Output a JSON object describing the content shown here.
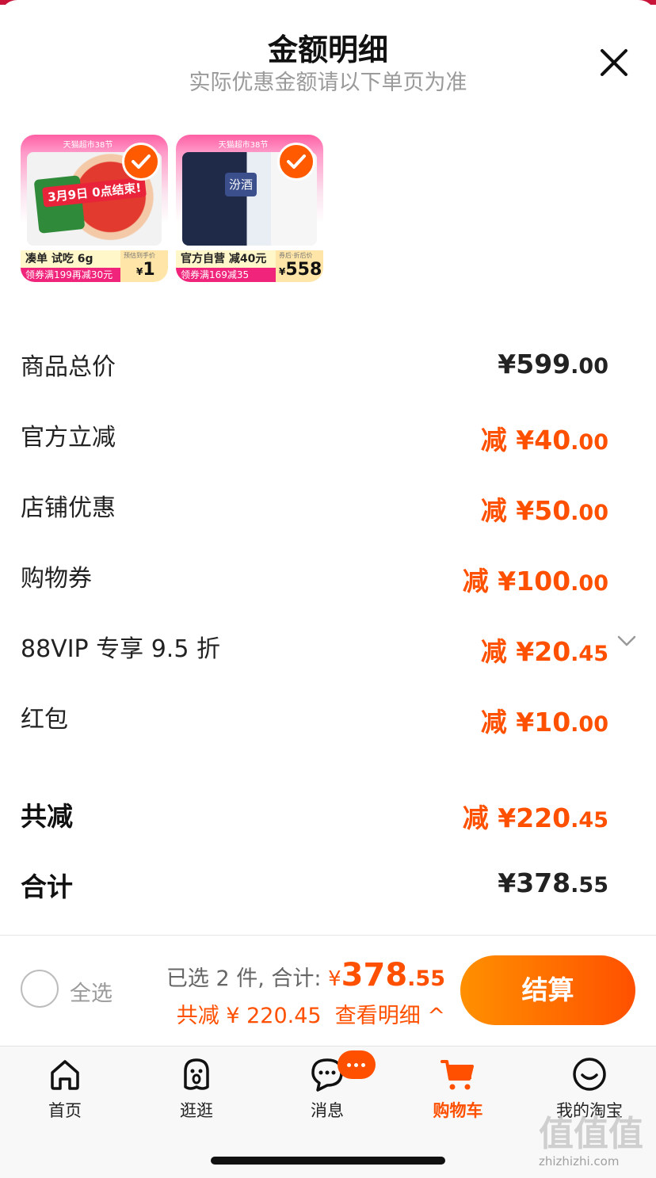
{
  "header": {
    "title": "金额明细",
    "subtitle": "实际优惠金额请以下单页为准"
  },
  "products": [
    {
      "top_tag": "天猫超市38节",
      "promo": "3月9日 0点结束!",
      "band": "凑单 试吃 6g",
      "coupon": "领券满199再减30元",
      "price_caption": "预估到手价",
      "currency": "¥",
      "price": "1",
      "selected": true
    },
    {
      "top_tag": "天猫超市38节",
      "box_text": "汾酒",
      "band": "官方自营 减40元",
      "coupon": "领券满169减35",
      "price_caption": "券后·折后价",
      "currency": "¥",
      "price": "558",
      "selected": true
    }
  ],
  "breakdown": {
    "rows": [
      {
        "label": "商品总价",
        "prefix": "",
        "int": "¥599",
        "dec": ".00"
      },
      {
        "label": "官方立减",
        "prefix": "减 ",
        "int": "¥40",
        "dec": ".00"
      },
      {
        "label": "店铺优惠",
        "prefix": "减 ",
        "int": "¥50",
        "dec": ".00"
      },
      {
        "label": "购物券",
        "prefix": "减 ",
        "int": "¥100",
        "dec": ".00"
      },
      {
        "label": "88VIP 专享 9.5 折",
        "prefix": "减 ",
        "int": "¥20",
        "dec": ".45"
      },
      {
        "label": "红包",
        "prefix": "减 ",
        "int": "¥10",
        "dec": ".00"
      }
    ],
    "total_discount": {
      "label": "共减",
      "prefix": "减 ",
      "int": "¥220",
      "dec": ".45"
    },
    "total": {
      "label": "合计",
      "int": "¥378",
      "dec": ".55"
    }
  },
  "footer": {
    "select_all": "全选",
    "selected_text": "已选 2 件, 合计:",
    "currency": "¥",
    "total_int": "378",
    "total_dec": ".55",
    "discount_text": "共减 ¥ 220.45",
    "detail_link": "查看明细 ^",
    "checkout": "结算"
  },
  "tabs": [
    {
      "label": "首页",
      "icon": "home-icon",
      "active": false
    },
    {
      "label": "逛逛",
      "icon": "guang-face-icon",
      "active": false
    },
    {
      "label": "消息",
      "icon": "message-icon",
      "active": false,
      "badge": "···"
    },
    {
      "label": "购物车",
      "icon": "cart-icon",
      "active": true
    },
    {
      "label": "我的淘宝",
      "icon": "smile-icon",
      "active": false
    }
  ],
  "colors": {
    "accent": "#ff5000",
    "muted": "#9a9a9a",
    "brand_top": "#c9143a"
  },
  "watermark": {
    "glyphs": "值值值",
    "url": "zhizhizhi.com"
  }
}
